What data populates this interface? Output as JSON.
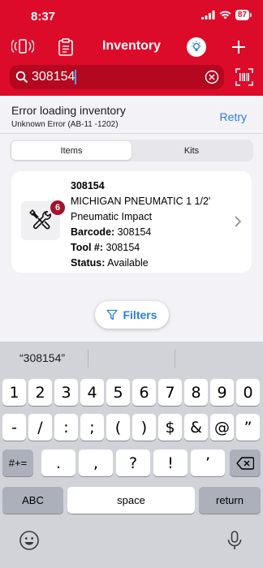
{
  "status_bar": {
    "time": "8:37",
    "battery": "87"
  },
  "nav": {
    "title": "Inventory"
  },
  "search": {
    "value": "308154"
  },
  "error": {
    "title": "Error loading inventory",
    "detail": "Unknown Error (AB-11 -1202)",
    "retry_label": "Retry"
  },
  "segments": {
    "items_label": "Items",
    "kits_label": "Kits",
    "selected": "Items"
  },
  "item": {
    "id": "308154",
    "name": "MICHIGAN PNEUMATIC  1 1/2' Pneumatic Impact",
    "barcode_label": "Barcode:",
    "barcode": "308154",
    "tool_label": "Tool #:",
    "tool": "308154",
    "status_label": "Status:",
    "status": "Available",
    "badge_count": "6"
  },
  "filters": {
    "label": "Filters"
  },
  "keyboard": {
    "suggestion": "“308154”",
    "row1": [
      "1",
      "2",
      "3",
      "4",
      "5",
      "6",
      "7",
      "8",
      "9",
      "0"
    ],
    "row2": [
      "-",
      "/",
      ":",
      ";",
      "(",
      ")",
      "$",
      "&",
      "@",
      "”"
    ],
    "row3_left": "#+=",
    "row3": [
      ".",
      ",",
      "?",
      "!",
      "’"
    ],
    "abc": "ABC",
    "space": "space",
    "return": "return"
  },
  "colors": {
    "brand_red": "#dc0b2a",
    "accent_blue": "#2b7de1",
    "badge_red": "#a5122a"
  }
}
